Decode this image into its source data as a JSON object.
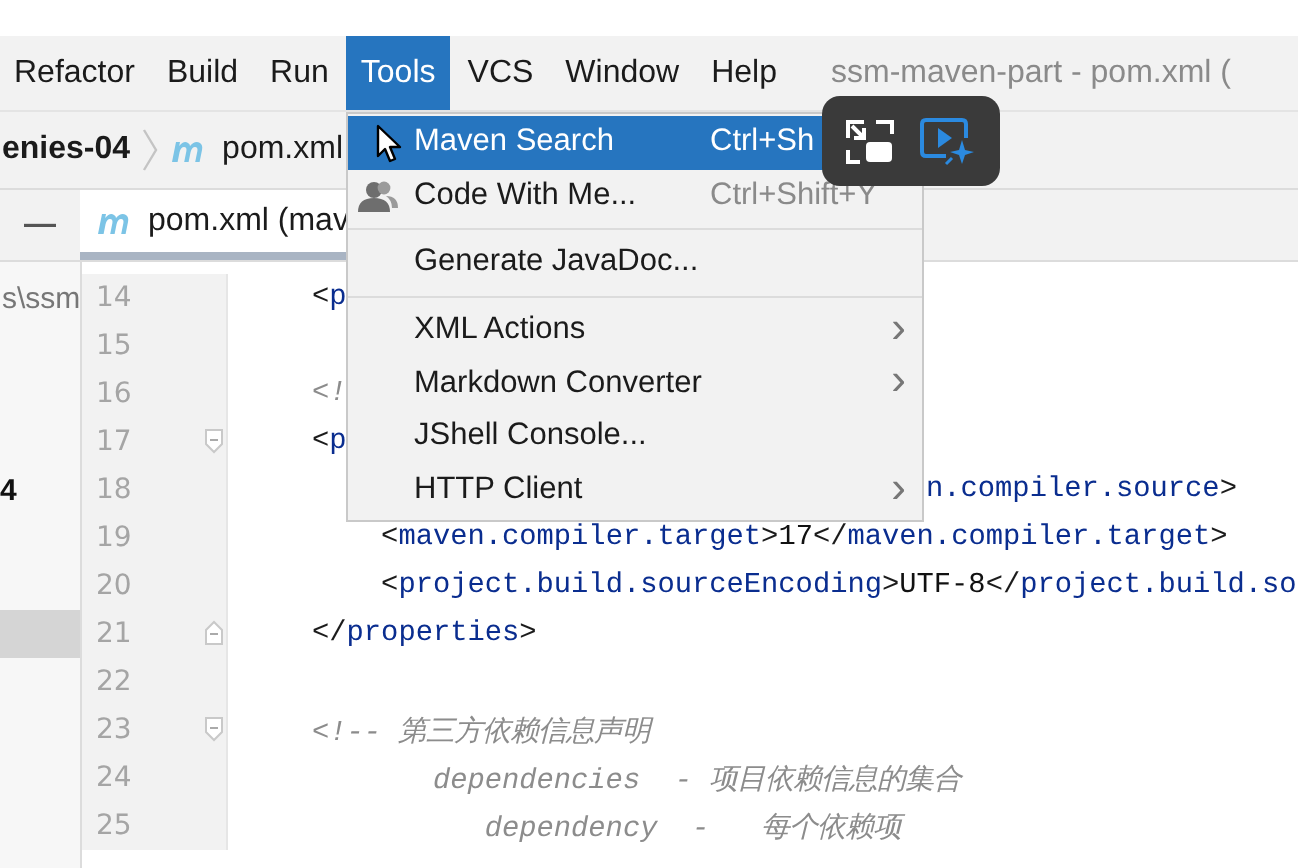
{
  "window": {
    "title": "ssm-maven-part - pom.xml ("
  },
  "menu_bar": [
    {
      "label": "Refactor",
      "selected": false
    },
    {
      "label": "Build",
      "selected": false
    },
    {
      "label": "Run",
      "selected": false
    },
    {
      "label": "Tools",
      "selected": true
    },
    {
      "label": "VCS",
      "selected": false
    },
    {
      "label": "Window",
      "selected": false
    },
    {
      "label": "Help",
      "selected": false
    }
  ],
  "breadcrumb": [
    {
      "kind": "folder",
      "label": "enies-04"
    },
    {
      "kind": "maven-file",
      "label": "pom.xml"
    }
  ],
  "project_panel": {
    "collapse_glyph": "—",
    "rows": [
      {
        "selected": false,
        "kind": "path",
        "label": "s\\ssm"
      },
      {
        "selected": false
      },
      {
        "selected": false
      },
      {
        "selected": false
      },
      {
        "selected": false,
        "kind": "module",
        "label": "4"
      },
      {
        "selected": false
      },
      {
        "selected": false
      },
      {
        "selected": true
      },
      {
        "selected": false
      },
      {
        "selected": false
      },
      {
        "selected": false
      },
      {
        "selected": false
      }
    ]
  },
  "tabs": [
    {
      "label": "pom.xml (mav",
      "selected": true
    }
  ],
  "editor": {
    "lines": [
      {
        "number": "14",
        "segments": [
          {
            "kind": "bracket",
            "text": "<"
          },
          {
            "kind": "tag",
            "text": "p"
          }
        ]
      },
      {
        "number": "15"
      },
      {
        "number": "16",
        "segments": [
          {
            "kind": "comment",
            "text": "<!"
          }
        ]
      },
      {
        "number": "17",
        "fold_start": true,
        "segments": [
          {
            "kind": "bracket",
            "text": "<"
          },
          {
            "kind": "tag",
            "text": "p"
          }
        ]
      },
      {
        "number": "18",
        "tail": [
          {
            "kind": "tag",
            "text": "n.compiler.source"
          },
          {
            "kind": "bracket",
            "text": ">"
          }
        ]
      },
      {
        "number": "19",
        "segments": [
          {
            "kind": "bracket",
            "text": "    <"
          },
          {
            "kind": "tag",
            "text": "maven.compiler.target"
          },
          {
            "kind": "bracket",
            "text": ">"
          },
          {
            "kind": "text",
            "text": "17"
          },
          {
            "kind": "bracket",
            "text": "</"
          },
          {
            "kind": "tag",
            "text": "maven.compiler.target"
          },
          {
            "kind": "bracket",
            "text": ">"
          }
        ]
      },
      {
        "number": "20",
        "segments": [
          {
            "kind": "bracket",
            "text": "    <"
          },
          {
            "kind": "tag",
            "text": "project.build.sourceEncoding"
          },
          {
            "kind": "bracket",
            "text": ">"
          },
          {
            "kind": "text",
            "text": "UTF-8"
          },
          {
            "kind": "bracket",
            "text": "</"
          },
          {
            "kind": "tag",
            "text": "project.build.so"
          }
        ]
      },
      {
        "number": "21",
        "fold_end": true,
        "segments": [
          {
            "kind": "bracket",
            "text": "</"
          },
          {
            "kind": "tag",
            "text": "properties"
          },
          {
            "kind": "bracket",
            "text": ">"
          }
        ]
      },
      {
        "number": "22"
      },
      {
        "number": "23",
        "fold_start": true,
        "segments": [
          {
            "kind": "comment",
            "text": "<!-- 第三方依赖信息声明"
          }
        ]
      },
      {
        "number": "24",
        "segments": [
          {
            "kind": "comment",
            "text": "       dependencies  - 项目依赖信息的集合"
          }
        ]
      },
      {
        "number": "25",
        "segments": [
          {
            "kind": "comment",
            "text": "          dependency  -   每个依赖项"
          }
        ]
      }
    ]
  },
  "tools_menu": [
    {
      "kind": "item",
      "label": "Maven Search",
      "shortcut": "Ctrl+Sh",
      "selected": true,
      "has_icon": false
    },
    {
      "kind": "item",
      "label": "Code With Me...",
      "shortcut": "Ctrl+Shift+Y",
      "selected": false,
      "has_icon": true
    },
    {
      "kind": "separator"
    },
    {
      "kind": "item",
      "label": "Generate JavaDoc...",
      "selected": false,
      "has_icon": false
    },
    {
      "kind": "separator"
    },
    {
      "kind": "submenu",
      "label": "XML Actions",
      "selected": false
    },
    {
      "kind": "submenu",
      "label": "Markdown Converter",
      "selected": false
    },
    {
      "kind": "item",
      "label": "JShell Console...",
      "selected": false,
      "has_icon": false
    },
    {
      "kind": "submenu",
      "label": "HTTP Client",
      "selected": false
    }
  ],
  "arrow_glyph": "›"
}
